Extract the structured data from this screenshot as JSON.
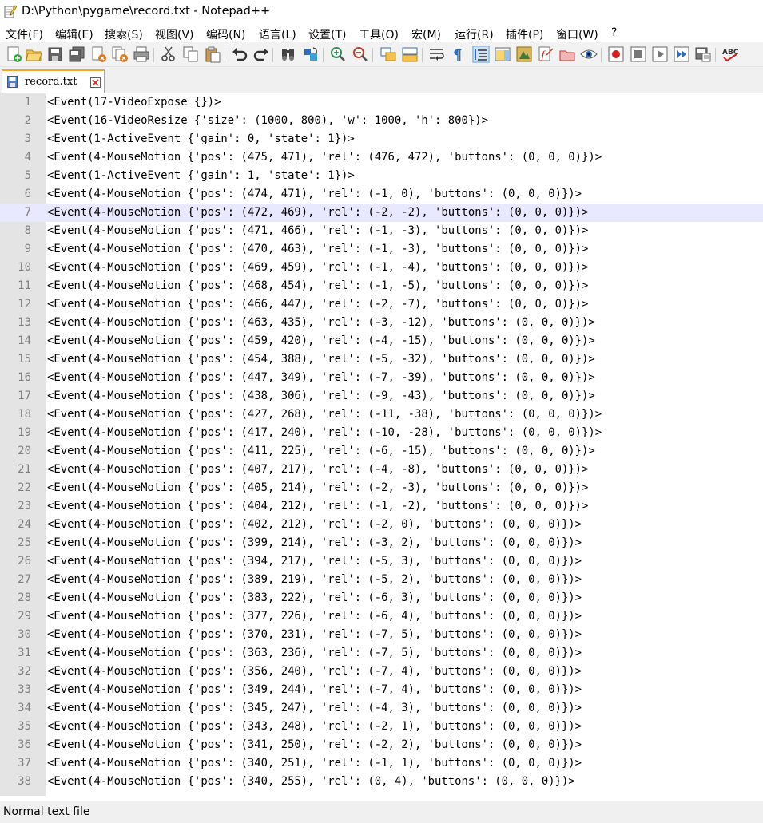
{
  "window": {
    "title": "D:\\Python\\pygame\\record.txt - Notepad++"
  },
  "menu": [
    "文件(F)",
    "编辑(E)",
    "搜索(S)",
    "视图(V)",
    "编码(N)",
    "语言(L)",
    "设置(T)",
    "工具(O)",
    "宏(M)",
    "运行(R)",
    "插件(P)",
    "窗口(W)",
    "?"
  ],
  "toolbar": [
    {
      "name": "new-file-icon"
    },
    {
      "name": "open-file-icon"
    },
    {
      "name": "save-icon"
    },
    {
      "name": "save-all-icon"
    },
    {
      "name": "close-file-icon"
    },
    {
      "name": "close-all-icon"
    },
    {
      "name": "print-icon"
    },
    {
      "name": "cut-icon"
    },
    {
      "name": "copy-icon"
    },
    {
      "name": "paste-icon"
    },
    {
      "name": "undo-icon"
    },
    {
      "name": "redo-icon"
    },
    {
      "name": "find-icon"
    },
    {
      "name": "replace-icon"
    },
    {
      "name": "zoom-in-icon"
    },
    {
      "name": "zoom-out-icon"
    },
    {
      "name": "sync-vertical-icon"
    },
    {
      "name": "sync-horizontal-icon"
    },
    {
      "name": "word-wrap-icon"
    },
    {
      "name": "show-all-chars-icon"
    },
    {
      "name": "indent-guide-icon"
    },
    {
      "name": "document-map-icon"
    },
    {
      "name": "function-list-icon"
    },
    {
      "name": "folder-workspace-icon"
    },
    {
      "name": "monitoring-icon"
    },
    {
      "name": "eye-icon"
    },
    {
      "name": "record-macro-icon"
    },
    {
      "name": "stop-record-icon"
    },
    {
      "name": "play-macro-icon"
    },
    {
      "name": "run-macro-multiple-icon"
    },
    {
      "name": "save-macro-icon"
    },
    {
      "name": "spell-check-icon"
    }
  ],
  "tab": {
    "label": "record.txt"
  },
  "editor": {
    "current_line": 7,
    "lines": [
      "<Event(17-VideoExpose {})>",
      "<Event(16-VideoResize {'size': (1000, 800), 'w': 1000, 'h': 800})>",
      "<Event(1-ActiveEvent {'gain': 0, 'state': 1})>",
      "<Event(4-MouseMotion {'pos': (475, 471), 'rel': (476, 472), 'buttons': (0, 0, 0)})>",
      "<Event(1-ActiveEvent {'gain': 1, 'state': 1})>",
      "<Event(4-MouseMotion {'pos': (474, 471), 'rel': (-1, 0), 'buttons': (0, 0, 0)})>",
      "<Event(4-MouseMotion {'pos': (472, 469), 'rel': (-2, -2), 'buttons': (0, 0, 0)})>",
      "<Event(4-MouseMotion {'pos': (471, 466), 'rel': (-1, -3), 'buttons': (0, 0, 0)})>",
      "<Event(4-MouseMotion {'pos': (470, 463), 'rel': (-1, -3), 'buttons': (0, 0, 0)})>",
      "<Event(4-MouseMotion {'pos': (469, 459), 'rel': (-1, -4), 'buttons': (0, 0, 0)})>",
      "<Event(4-MouseMotion {'pos': (468, 454), 'rel': (-1, -5), 'buttons': (0, 0, 0)})>",
      "<Event(4-MouseMotion {'pos': (466, 447), 'rel': (-2, -7), 'buttons': (0, 0, 0)})>",
      "<Event(4-MouseMotion {'pos': (463, 435), 'rel': (-3, -12), 'buttons': (0, 0, 0)})>",
      "<Event(4-MouseMotion {'pos': (459, 420), 'rel': (-4, -15), 'buttons': (0, 0, 0)})>",
      "<Event(4-MouseMotion {'pos': (454, 388), 'rel': (-5, -32), 'buttons': (0, 0, 0)})>",
      "<Event(4-MouseMotion {'pos': (447, 349), 'rel': (-7, -39), 'buttons': (0, 0, 0)})>",
      "<Event(4-MouseMotion {'pos': (438, 306), 'rel': (-9, -43), 'buttons': (0, 0, 0)})>",
      "<Event(4-MouseMotion {'pos': (427, 268), 'rel': (-11, -38), 'buttons': (0, 0, 0)})>",
      "<Event(4-MouseMotion {'pos': (417, 240), 'rel': (-10, -28), 'buttons': (0, 0, 0)})>",
      "<Event(4-MouseMotion {'pos': (411, 225), 'rel': (-6, -15), 'buttons': (0, 0, 0)})>",
      "<Event(4-MouseMotion {'pos': (407, 217), 'rel': (-4, -8), 'buttons': (0, 0, 0)})>",
      "<Event(4-MouseMotion {'pos': (405, 214), 'rel': (-2, -3), 'buttons': (0, 0, 0)})>",
      "<Event(4-MouseMotion {'pos': (404, 212), 'rel': (-1, -2), 'buttons': (0, 0, 0)})>",
      "<Event(4-MouseMotion {'pos': (402, 212), 'rel': (-2, 0), 'buttons': (0, 0, 0)})>",
      "<Event(4-MouseMotion {'pos': (399, 214), 'rel': (-3, 2), 'buttons': (0, 0, 0)})>",
      "<Event(4-MouseMotion {'pos': (394, 217), 'rel': (-5, 3), 'buttons': (0, 0, 0)})>",
      "<Event(4-MouseMotion {'pos': (389, 219), 'rel': (-5, 2), 'buttons': (0, 0, 0)})>",
      "<Event(4-MouseMotion {'pos': (383, 222), 'rel': (-6, 3), 'buttons': (0, 0, 0)})>",
      "<Event(4-MouseMotion {'pos': (377, 226), 'rel': (-6, 4), 'buttons': (0, 0, 0)})>",
      "<Event(4-MouseMotion {'pos': (370, 231), 'rel': (-7, 5), 'buttons': (0, 0, 0)})>",
      "<Event(4-MouseMotion {'pos': (363, 236), 'rel': (-7, 5), 'buttons': (0, 0, 0)})>",
      "<Event(4-MouseMotion {'pos': (356, 240), 'rel': (-7, 4), 'buttons': (0, 0, 0)})>",
      "<Event(4-MouseMotion {'pos': (349, 244), 'rel': (-7, 4), 'buttons': (0, 0, 0)})>",
      "<Event(4-MouseMotion {'pos': (345, 247), 'rel': (-4, 3), 'buttons': (0, 0, 0)})>",
      "<Event(4-MouseMotion {'pos': (343, 248), 'rel': (-2, 1), 'buttons': (0, 0, 0)})>",
      "<Event(4-MouseMotion {'pos': (341, 250), 'rel': (-2, 2), 'buttons': (0, 0, 0)})>",
      "<Event(4-MouseMotion {'pos': (340, 251), 'rel': (-1, 1), 'buttons': (0, 0, 0)})>",
      "<Event(4-MouseMotion {'pos': (340, 255), 'rel': (0, 4), 'buttons': (0, 0, 0)})>"
    ]
  },
  "status": {
    "file_type": "Normal text file"
  },
  "colors": {
    "current_line": "#e8e8ff",
    "gutter": "#e4e4e4",
    "line_number": "#808080",
    "tab_accent": "#f5a623"
  }
}
